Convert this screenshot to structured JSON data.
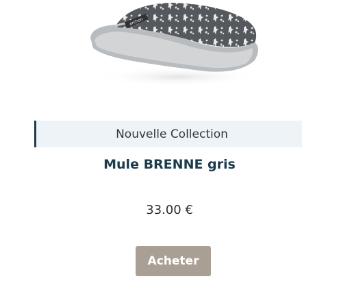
{
  "product": {
    "image_alt": "Mule BRENNE gris",
    "brand_tag": "archon",
    "collection": "Nouvelle Collection",
    "title": "Mule BRENNE gris",
    "price": "33.00 €",
    "buy_label": "Acheter"
  },
  "colors": {
    "accent_border": "#1d3c4e",
    "banner_bg": "#eef3f7",
    "title": "#1b3a4b",
    "button_bg": "#a99f94",
    "button_text": "#ffffff"
  }
}
